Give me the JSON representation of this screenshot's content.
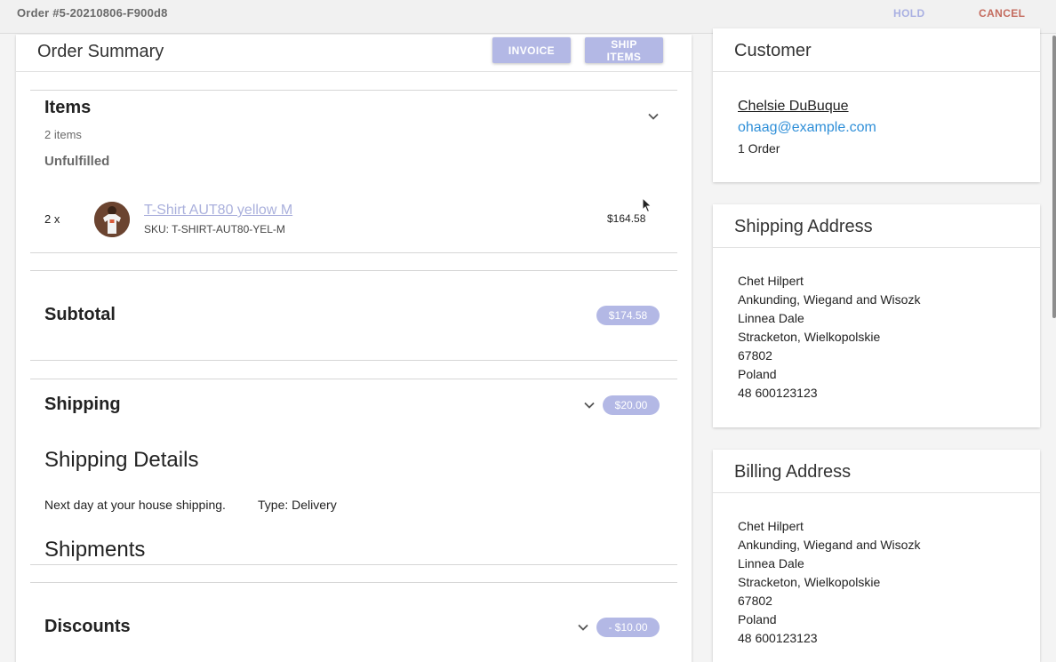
{
  "header": {
    "order_title": "Order #5-20210806-F900d8",
    "hold_label": "HOLD",
    "cancel_label": "CANCEL"
  },
  "summary": {
    "title": "Order Summary",
    "invoice_label": "INVOICE",
    "ship_items_label": "SHIP ITEMS",
    "items": {
      "title": "Items",
      "count": "2 items",
      "status": "Unfulfilled",
      "line": {
        "quantity": "2 x",
        "name": "T-Shirt AUT80 yellow M",
        "sku": "SKU: T-SHIRT-AUT80-YEL-M",
        "price": "$164.58"
      }
    },
    "subtotal": {
      "title": "Subtotal",
      "amount": "$174.58"
    },
    "shipping": {
      "title": "Shipping",
      "amount": "$20.00",
      "details_title": "Shipping Details",
      "method": "Next day at your house shipping.",
      "type": "Type: Delivery",
      "shipments_title": "Shipments"
    },
    "discounts": {
      "title": "Discounts",
      "amount": "- $10.00"
    }
  },
  "customer": {
    "title": "Customer",
    "name": "Chelsie DuBuque",
    "email": "ohaag@example.com",
    "orders": "1 Order"
  },
  "shipping_address": {
    "title": "Shipping Address",
    "lines": [
      "Chet Hilpert",
      "Ankunding, Wiegand and Wisozk",
      "Linnea Dale",
      "Stracketon, Wielkopolskie",
      "67802",
      "Poland",
      "48 600123123"
    ]
  },
  "billing_address": {
    "title": "Billing Address",
    "lines": [
      "Chet Hilpert",
      "Ankunding, Wiegand and Wisozk",
      "Linnea Dale",
      "Stracketon, Wielkopolskie",
      "67802",
      "Poland",
      "48 600123123"
    ]
  },
  "colors": {
    "accent_button": "#b3b8e5",
    "link_blue": "#2f8fd8",
    "cancel_red": "#c46b5e"
  }
}
